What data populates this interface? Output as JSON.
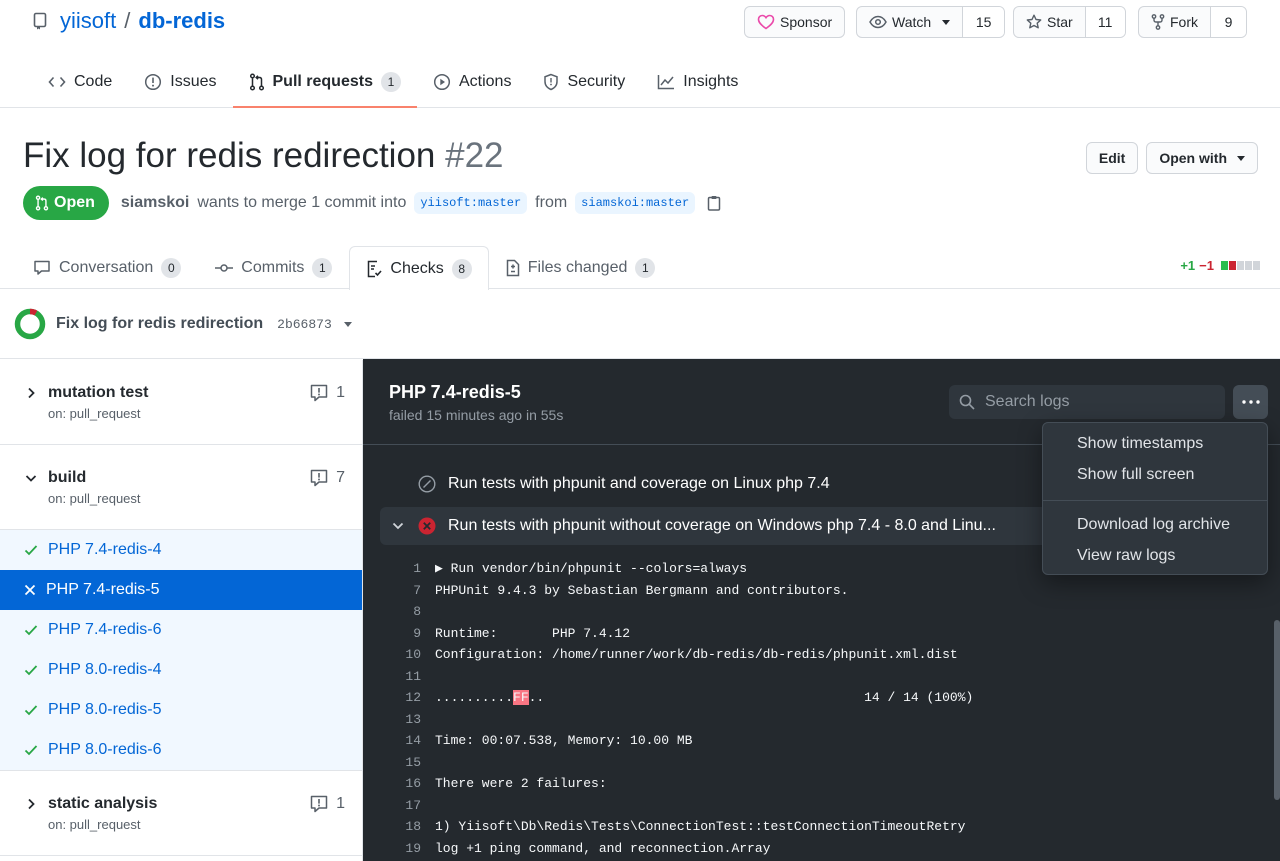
{
  "repo": {
    "owner": "yiisoft",
    "name": "db-redis"
  },
  "actions": {
    "sponsor": "Sponsor",
    "watch": "Watch",
    "watch_count": "15",
    "star": "Star",
    "star_count": "11",
    "fork": "Fork",
    "fork_count": "9"
  },
  "nav": [
    {
      "label": "Code"
    },
    {
      "label": "Issues"
    },
    {
      "label": "Pull requests",
      "count": "1"
    },
    {
      "label": "Actions"
    },
    {
      "label": "Security"
    },
    {
      "label": "Insights"
    }
  ],
  "pr": {
    "title": "Fix log for redis redirection",
    "number": "#22",
    "state": "Open",
    "author": "siamskoi",
    "merge_text": "wants to merge 1 commit into",
    "base": "yiisoft:master",
    "from_text": "from",
    "head": "siamskoi:master",
    "edit": "Edit",
    "open_with": "Open with"
  },
  "tabs": [
    {
      "label": "Conversation",
      "count": "0"
    },
    {
      "label": "Commits",
      "count": "1"
    },
    {
      "label": "Checks",
      "count": "8"
    },
    {
      "label": "Files changed",
      "count": "1"
    }
  ],
  "diffstat": {
    "additions": "+1",
    "deletions": "−1"
  },
  "checks": {
    "title": "Fix log for redis redirection",
    "sha": "2b66873"
  },
  "workflows": [
    {
      "name": "mutation test",
      "event": "on: pull_request",
      "annotations": "1"
    },
    {
      "name": "build",
      "event": "on: pull_request",
      "annotations": "7"
    },
    {
      "name": "static analysis",
      "event": "on: pull_request",
      "annotations": "1"
    }
  ],
  "jobs": [
    {
      "name": "PHP 7.4-redis-4",
      "status": "success"
    },
    {
      "name": "PHP 7.4-redis-5",
      "status": "failure"
    },
    {
      "name": "PHP 7.4-redis-6",
      "status": "success"
    },
    {
      "name": "PHP 8.0-redis-4",
      "status": "success"
    },
    {
      "name": "PHP 8.0-redis-5",
      "status": "success"
    },
    {
      "name": "PHP 8.0-redis-6",
      "status": "success"
    }
  ],
  "log": {
    "job_title": "PHP 7.4-redis-5",
    "job_status": "failed 15 minutes ago in 55s",
    "search_placeholder": "Search logs",
    "steps": [
      {
        "name": "Run tests with phpunit and coverage on Linux php 7.4",
        "status": "skipped"
      },
      {
        "name": "Run tests with phpunit without coverage on Windows php 7.4 - 8.0 and Linu...",
        "status": "failed"
      }
    ],
    "lines": [
      {
        "n": "1",
        "text": "▶ Run vendor/bin/phpunit --colors=always"
      },
      {
        "n": "7",
        "text": "PHPUnit 9.4.3 by Sebastian Bergmann and contributors."
      },
      {
        "n": "8",
        "text": ""
      },
      {
        "n": "9",
        "text": "Runtime:       PHP 7.4.12"
      },
      {
        "n": "10",
        "text": "Configuration: /home/runner/work/db-redis/db-redis/phpunit.xml.dist"
      },
      {
        "n": "11",
        "text": ""
      },
      {
        "n": "12",
        "pre": "..........",
        "ff": "FF",
        "post": "..                                         14 / 14 (100%)"
      },
      {
        "n": "13",
        "text": ""
      },
      {
        "n": "14",
        "text": "Time: 00:07.538, Memory: 10.00 MB"
      },
      {
        "n": "15",
        "text": ""
      },
      {
        "n": "16",
        "text": "There were 2 failures:"
      },
      {
        "n": "17",
        "text": ""
      },
      {
        "n": "18",
        "text": "1) Yiisoft\\Db\\Redis\\Tests\\ConnectionTest::testConnectionTimeoutRetry"
      },
      {
        "n": "19",
        "text": "log +1 ping command, and reconnection.Array"
      }
    ]
  },
  "menu": {
    "items": [
      "Show timestamps",
      "Show full screen"
    ],
    "items2": [
      "Download log archive",
      "View raw logs"
    ]
  },
  "colors": {
    "success": "#28a745",
    "failure": "#cb2431",
    "accent": "#0366d6",
    "tab_underline": "#f9826c"
  }
}
